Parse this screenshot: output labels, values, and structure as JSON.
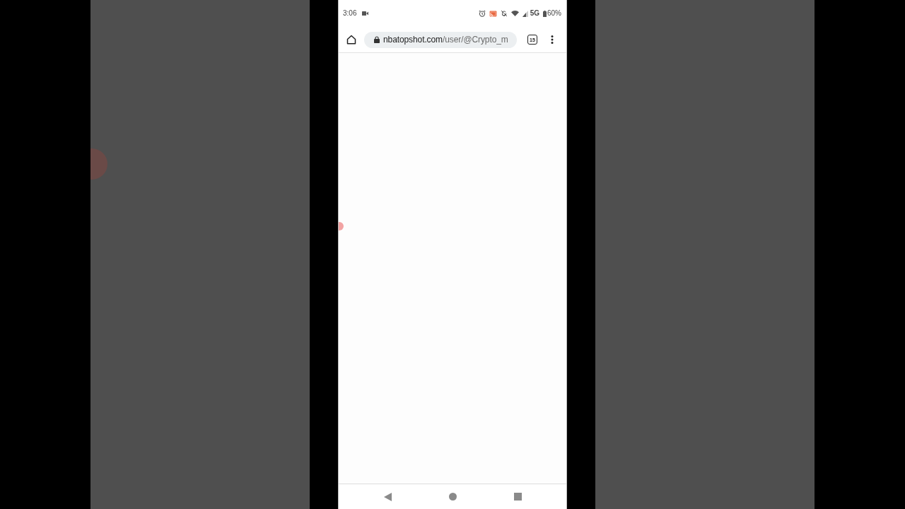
{
  "status_bar": {
    "time": "3:06",
    "network": "5G",
    "battery": "60%"
  },
  "browser_toolbar": {
    "url": {
      "host": "nbatopshot.com",
      "path": "/user/@Crypto_m"
    },
    "tab_count": "15"
  }
}
